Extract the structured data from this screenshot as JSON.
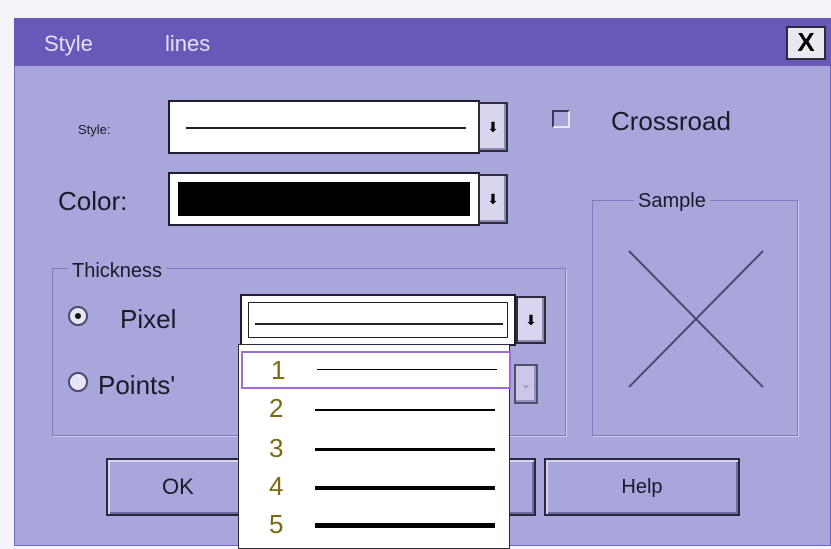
{
  "dialog": {
    "title_left": "Style",
    "title_right": "lines",
    "close_label": "X"
  },
  "style_row": {
    "label": "Style:",
    "arrow": "⬇"
  },
  "crossroad": {
    "label": "Crossroad",
    "checked": false
  },
  "color_row": {
    "label": "Color:",
    "value_color": "#000000",
    "arrow": "⬇"
  },
  "sample": {
    "caption": "Sample",
    "icon": "x-cross-sample-icon"
  },
  "thickness": {
    "caption": "Thickness",
    "pixel_label": "Pixel",
    "points_label": "Points'",
    "pixel_selected": true,
    "arrow": "⬇",
    "points_arrow": "⌄"
  },
  "dropdown": {
    "items": [
      {
        "label": "1",
        "thickness": 1
      },
      {
        "label": "2",
        "thickness": 2
      },
      {
        "label": "3",
        "thickness": 3
      },
      {
        "label": "4",
        "thickness": 4
      },
      {
        "label": "5",
        "thickness": 5
      }
    ],
    "selected_index": 0
  },
  "buttons": {
    "ok": "OK",
    "help": "Help"
  },
  "colors": {
    "dialog_bg": "#a9a6dc",
    "titlebar": "#6759b8",
    "selected_outline": "#9f6bd6"
  }
}
